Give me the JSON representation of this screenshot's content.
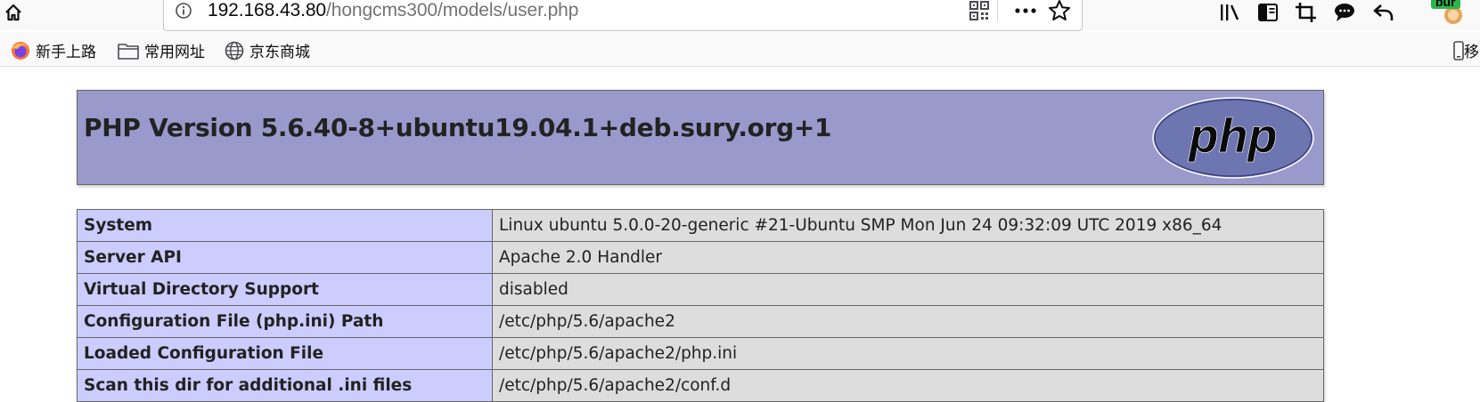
{
  "browser": {
    "url_host": "192.168.43.80",
    "url_path": "/hongcms300/models/user.php",
    "profile_badge": "bur",
    "bookmarks": [
      {
        "label": "新手上路",
        "icon": "firefox-icon"
      },
      {
        "label": "常用网址",
        "icon": "folder-icon"
      },
      {
        "label": "京东商城",
        "icon": "globe-icon"
      }
    ],
    "mobile_bookmarks_label": "移"
  },
  "phpinfo": {
    "title": "PHP Version 5.6.40-8+ubuntu19.04.1+deb.sury.org+1",
    "logo_text": "php",
    "rows": [
      {
        "key": "System",
        "value": "Linux ubuntu 5.0.0-20-generic #21-Ubuntu SMP Mon Jun 24 09:32:09 UTC 2019 x86_64"
      },
      {
        "key": "Server API",
        "value": "Apache 2.0 Handler"
      },
      {
        "key": "Virtual Directory Support",
        "value": "disabled"
      },
      {
        "key": "Configuration File (php.ini) Path",
        "value": "/etc/php/5.6/apache2"
      },
      {
        "key": "Loaded Configuration File",
        "value": "/etc/php/5.6/apache2/php.ini"
      },
      {
        "key": "Scan this dir for additional .ini files",
        "value": "/etc/php/5.6/apache2/conf.d"
      }
    ]
  },
  "colors": {
    "header_bg": "#9999cc",
    "key_cell_bg": "#ccccff",
    "value_cell_bg": "#dddddd",
    "logo_bg": "#6e76b2"
  }
}
